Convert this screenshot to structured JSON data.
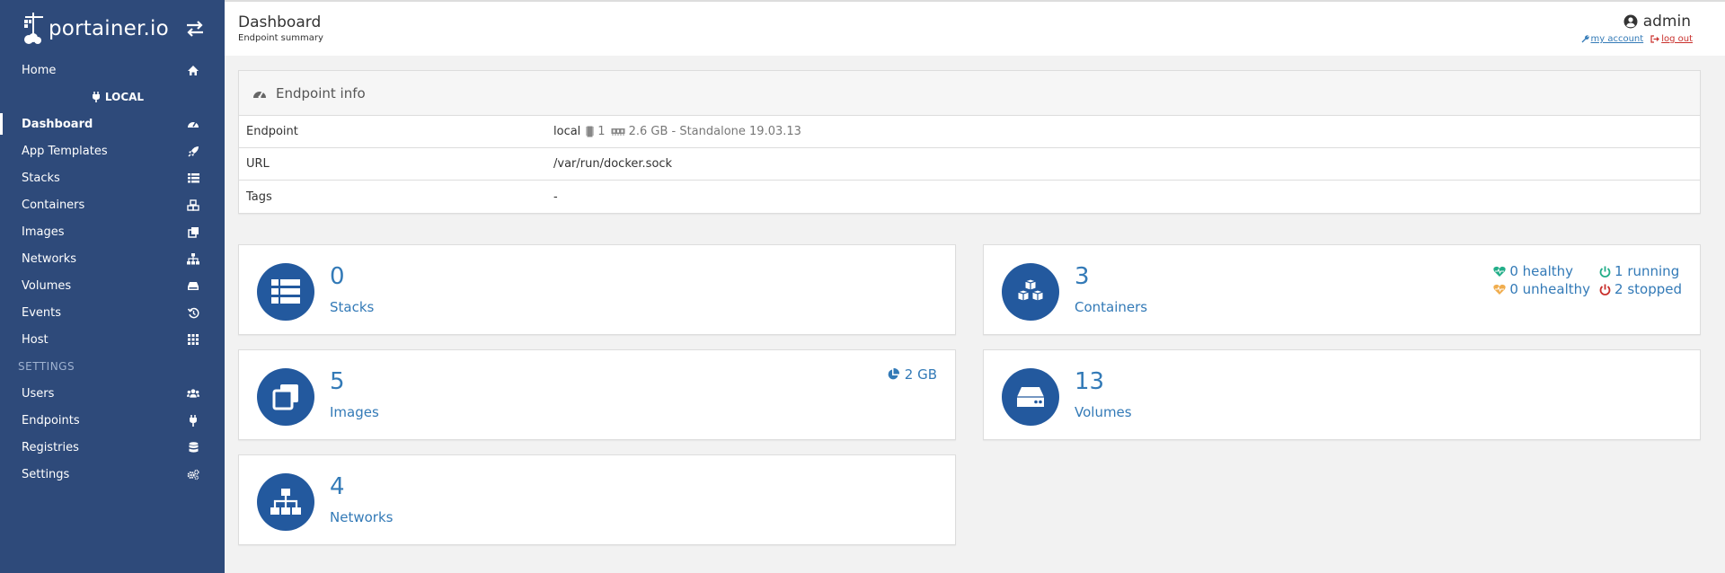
{
  "brand": {
    "logo_text": "portainer.io"
  },
  "sidebar": {
    "items": [
      {
        "label": "Home",
        "icon": "home-icon"
      }
    ],
    "endpoint_label": "LOCAL",
    "endpoint_items": [
      {
        "label": "Dashboard",
        "icon": "dashboard-icon",
        "active": true
      },
      {
        "label": "App Templates",
        "icon": "rocket-icon"
      },
      {
        "label": "Stacks",
        "icon": "list-icon"
      },
      {
        "label": "Containers",
        "icon": "cubes-icon"
      },
      {
        "label": "Images",
        "icon": "clone-icon"
      },
      {
        "label": "Networks",
        "icon": "sitemap-icon"
      },
      {
        "label": "Volumes",
        "icon": "hdd-icon"
      },
      {
        "label": "Events",
        "icon": "history-icon"
      },
      {
        "label": "Host",
        "icon": "th-icon"
      }
    ],
    "settings_header": "SETTINGS",
    "settings_items": [
      {
        "label": "Users",
        "icon": "users-icon"
      },
      {
        "label": "Endpoints",
        "icon": "plug-icon"
      },
      {
        "label": "Registries",
        "icon": "database-icon"
      },
      {
        "label": "Settings",
        "icon": "cogs-icon"
      }
    ]
  },
  "header": {
    "title": "Dashboard",
    "subtitle": "Endpoint summary",
    "username": "admin",
    "my_account": "my account",
    "log_out": "log out"
  },
  "endpoint_info": {
    "title": "Endpoint info",
    "rows": {
      "endpoint": {
        "key": "Endpoint",
        "name": "local",
        "cpu": "1",
        "memory": "2.6 GB - Standalone 19.03.13"
      },
      "url": {
        "key": "URL",
        "value": "/var/run/docker.sock"
      },
      "tags": {
        "key": "Tags",
        "value": "-"
      }
    }
  },
  "tiles": {
    "stacks": {
      "count": "0",
      "label": "Stacks"
    },
    "containers": {
      "count": "3",
      "label": "Containers",
      "healthy": "0 healthy",
      "running": "1 running",
      "unhealthy": "0 unhealthy",
      "stopped": "2 stopped"
    },
    "images": {
      "count": "5",
      "label": "Images",
      "size": "2 GB"
    },
    "volumes": {
      "count": "13",
      "label": "Volumes"
    },
    "networks": {
      "count": "4",
      "label": "Networks"
    }
  },
  "colors": {
    "sidebar": "#2e4a7a",
    "accent": "#337ab7",
    "tile_icon_bg": "#23599e",
    "healthy": "#23ae89",
    "unhealthy": "#f0ad4e",
    "stopped": "#c9302c"
  }
}
